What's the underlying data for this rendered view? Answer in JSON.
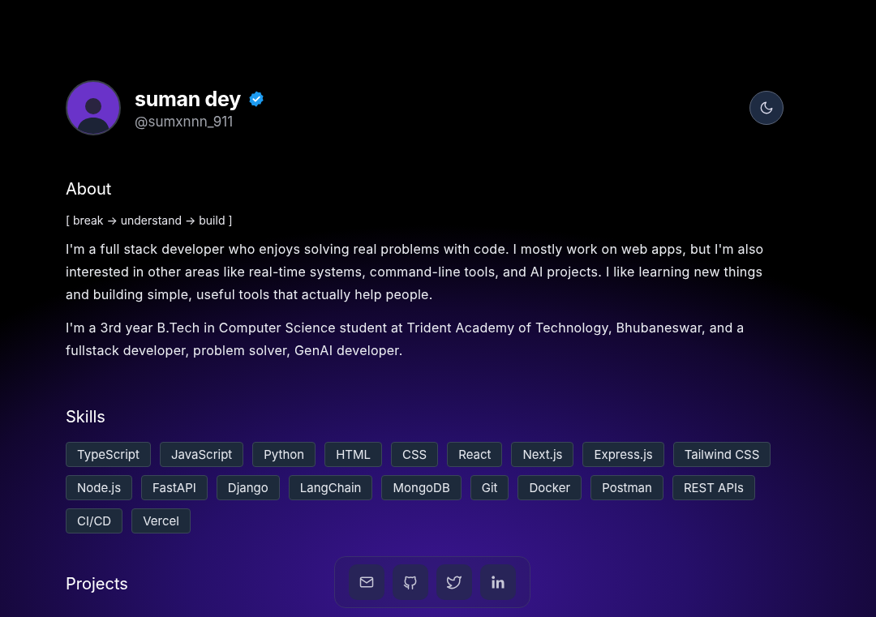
{
  "profile": {
    "name": "suman dey",
    "verified": true,
    "handle": "@sumxnnn_911"
  },
  "theme_toggle": {
    "dark_mode": true
  },
  "about": {
    "heading": "About",
    "tagline": "[ break → understand → build ]",
    "paragraphs": [
      "I'm a full stack developer who enjoys solving real problems with code. I mostly work on web apps, but I'm also interested in other areas like real-time systems, command-line tools, and AI projects. I like learning new things and building simple, useful tools that actually help people.",
      "I'm a 3rd year B.Tech in Computer Science student at Trident Academy of Technology, Bhubaneswar, and a fullstack developer, problem solver, GenAI developer."
    ]
  },
  "skills": {
    "heading": "Skills",
    "items": [
      "TypeScript",
      "JavaScript",
      "Python",
      "HTML",
      "CSS",
      "React",
      "Next.js",
      "Express.js",
      "Tailwind CSS",
      "Node.js",
      "FastAPI",
      "Django",
      "LangChain",
      "MongoDB",
      "Git",
      "Docker",
      "Postman",
      "REST APIs",
      "CI/CD",
      "Vercel"
    ]
  },
  "projects": {
    "heading": "Projects"
  },
  "social_links": [
    {
      "kind": "email"
    },
    {
      "kind": "github"
    },
    {
      "kind": "twitter"
    },
    {
      "kind": "linkedin"
    }
  ]
}
